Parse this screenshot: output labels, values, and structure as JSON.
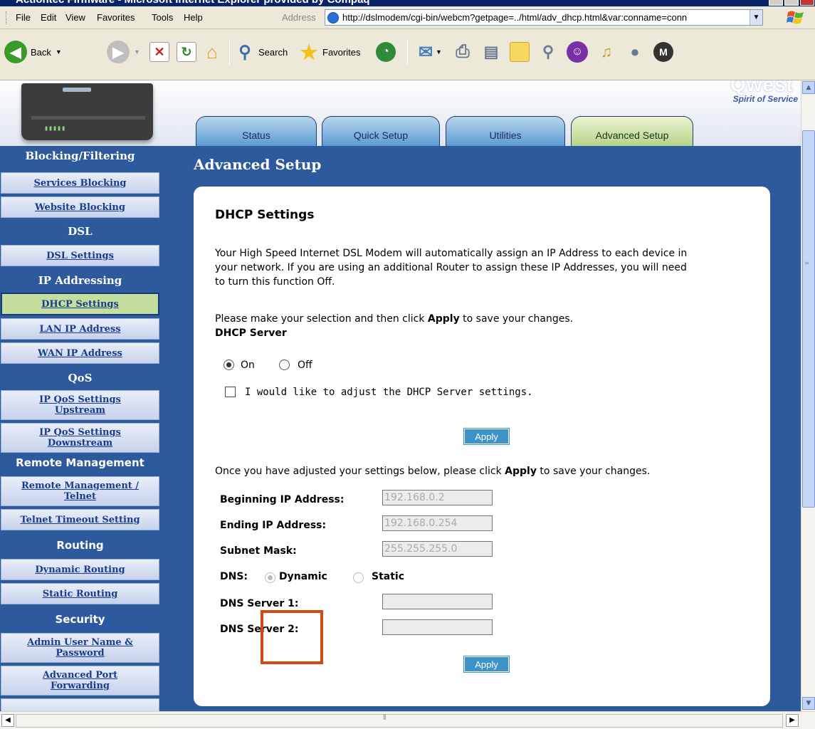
{
  "window": {
    "title": "Actiontec Firmware - Microsoft Internet Explorer provided by Compaq"
  },
  "menu": {
    "items": [
      "File",
      "Edit",
      "View",
      "Favorites",
      "Tools",
      "Help"
    ],
    "address_label": "Address",
    "address_url": "http://dslmodem/cgi-bin/webcm?getpage=../html/adv_dhcp.html&var:conname=conn"
  },
  "toolbar": {
    "back": "Back",
    "search": "Search",
    "favorites": "Favorites"
  },
  "banner": {
    "logo_text": "Qwest",
    "tagline": "Spirit of Service"
  },
  "tabs": [
    {
      "label": "Status",
      "active": false
    },
    {
      "label": "Quick Setup",
      "active": false
    },
    {
      "label": "Utilities",
      "active": false
    },
    {
      "label": "Advanced Setup",
      "active": true
    }
  ],
  "sidebar": {
    "sections": [
      {
        "header": "Blocking/Filtering",
        "items": [
          "Services Blocking",
          "Website Blocking"
        ]
      },
      {
        "header": "DSL",
        "items": [
          "DSL Settings"
        ]
      },
      {
        "header": "IP Addressing",
        "items": [
          "DHCP Settings",
          "LAN IP Address",
          "WAN IP Address"
        ]
      },
      {
        "header": "QoS",
        "items": [
          "IP QoS Settings Upstream",
          "IP QoS Settings Downstream"
        ]
      },
      {
        "header": "Remote Management",
        "items": [
          "Remote Management / Telnet",
          "Telnet Timeout Setting"
        ]
      },
      {
        "header": "Routing",
        "items": [
          "Dynamic Routing",
          "Static Routing"
        ]
      },
      {
        "header": "Security",
        "items": [
          "Admin User Name & Password",
          "Advanced Port Forwarding"
        ]
      }
    ],
    "selected": "DHCP Settings"
  },
  "main": {
    "heading": "Advanced Setup",
    "section_title": "DHCP Settings",
    "intro_line1": "Your High Speed Internet DSL Modem will automatically assign an IP Address to each device in",
    "intro_line2": "your network. If you are using an additional Router to assign these IP Addresses, you will need",
    "intro_line3": "to turn this function Off.",
    "select_pre": "Please make your selection and then click ",
    "select_bold": "Apply",
    "select_post": " to save your changes.",
    "dhcp_server_label": "DHCP Server",
    "on_label": "On",
    "off_label": "Off",
    "dhcp_on": true,
    "adjust_checkbox_label": "I would like to adjust the DHCP Server settings.",
    "adjust_checked": false,
    "apply_label": "Apply",
    "adjusted_pre": "Once you have adjusted your settings below, please click ",
    "adjusted_bold": "Apply",
    "adjusted_post": " to save your changes.",
    "fields": {
      "begin_label": "Beginning IP Address:",
      "begin_value": "192.168.0.2",
      "end_label": "Ending IP Address:",
      "end_value": "192.168.0.254",
      "mask_label": "Subnet Mask:",
      "mask_value": "255.255.255.0",
      "dns_label": "DNS:",
      "dns_dynamic": "Dynamic",
      "dns_static": "Static",
      "dns1_label": "DNS Server 1:",
      "dns1_value": "",
      "dns2_label": "DNS Server 2:",
      "dns2_value": ""
    },
    "apply2_label": "Apply"
  },
  "colors": {
    "page_bg": "#2d5a9c",
    "highlight": "#d24a10",
    "button": "#3b93c8"
  }
}
